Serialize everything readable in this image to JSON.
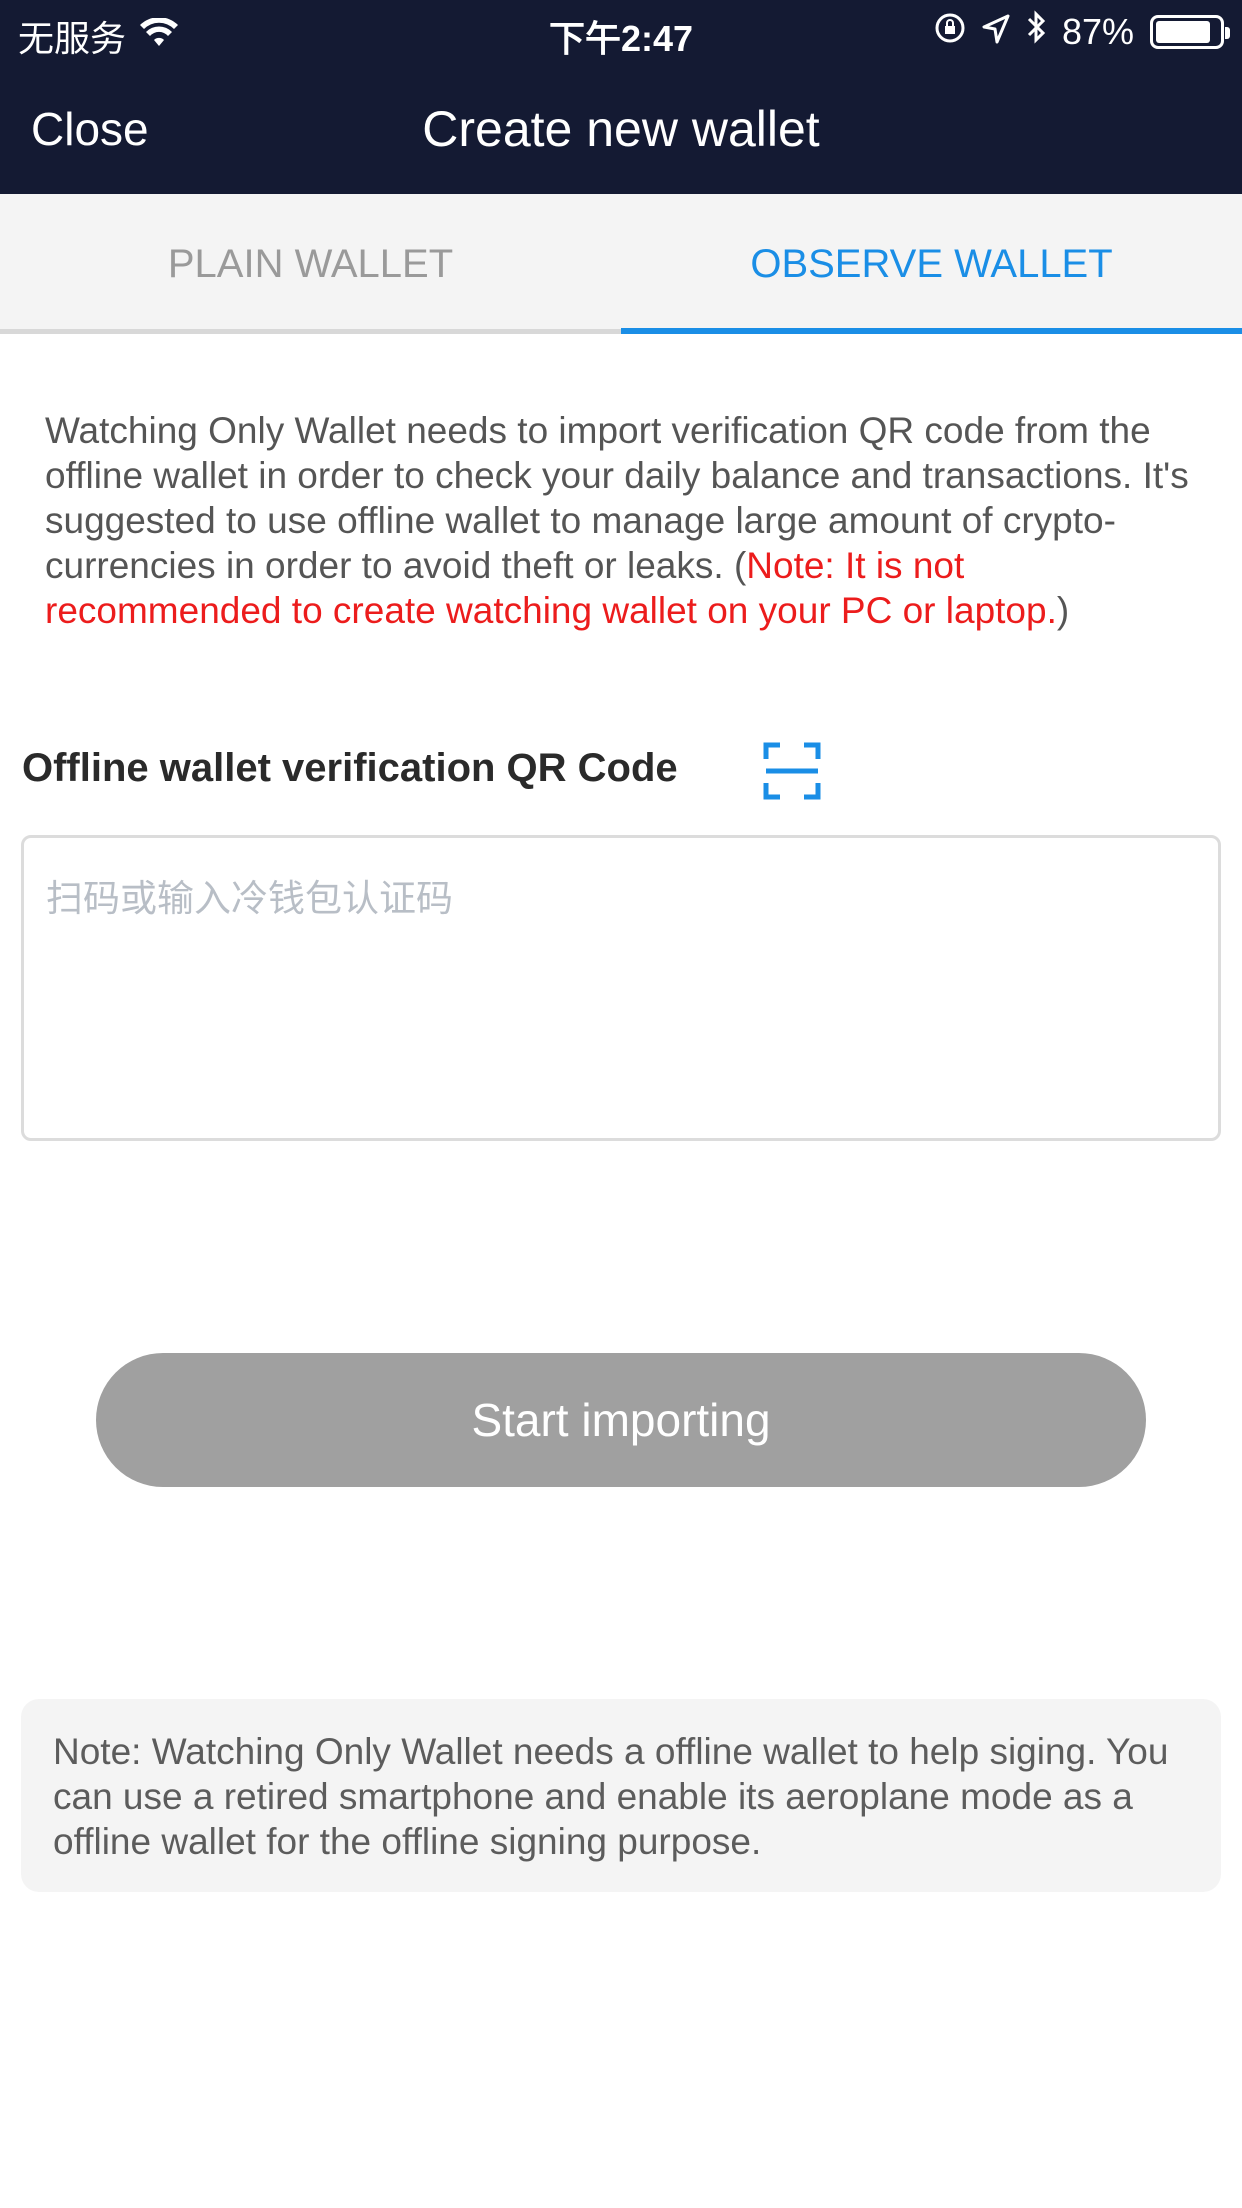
{
  "status_bar": {
    "carrier": "无服务",
    "time": "下午2:47",
    "battery": "87%",
    "battery_level": 0.87,
    "icons": [
      "wifi-icon",
      "rotation-lock-icon",
      "location-icon",
      "bluetooth-icon",
      "battery-icon"
    ]
  },
  "nav": {
    "close_label": "Close",
    "title": "Create new wallet"
  },
  "tabs": [
    {
      "label": "PLAIN WALLET",
      "active": false
    },
    {
      "label": "OBSERVE WALLET",
      "active": true
    }
  ],
  "description": {
    "text": "Watching Only Wallet needs to import verification QR code from the offline wallet in order to check your daily balance and transactions. It's suggested to use offline wallet to manage large amount of crypto-currencies in order to avoid theft or leaks. (",
    "note": "Note: It is not recommended to create watching wallet on your PC or laptop.",
    "close_paren": ")"
  },
  "qr_field": {
    "label": "Offline wallet verification QR Code",
    "placeholder": "扫码或输入冷钱包认证码",
    "value": ""
  },
  "import_button": {
    "label": "Start importing"
  },
  "footer_note": "Note: Watching Only Wallet needs a offline wallet to help siging. You can use a retired smartphone and enable its aeroplane mode as a offline wallet for the offline signing purpose.",
  "colors": {
    "header_bg": "#141a33",
    "accent": "#1a8ee6",
    "warning": "#ec1c1c",
    "button_disabled": "#a0a0a0"
  }
}
